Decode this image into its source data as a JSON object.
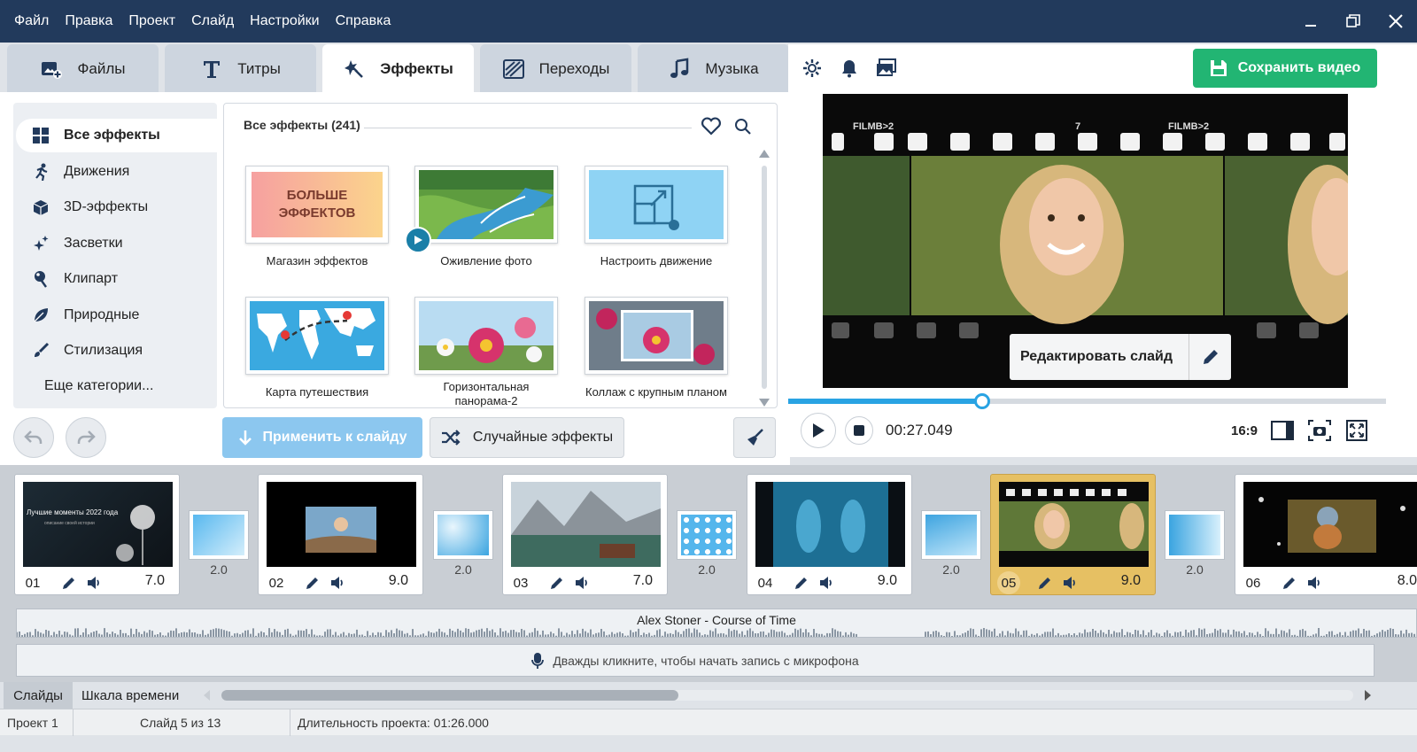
{
  "menu": [
    "Файл",
    "Правка",
    "Проект",
    "Слайд",
    "Настройки",
    "Справка"
  ],
  "tabs": [
    {
      "label": "Файлы",
      "icon": "add-photo-icon"
    },
    {
      "label": "Титры",
      "icon": "text-t-icon"
    },
    {
      "label": "Эффекты",
      "icon": "effects-star-icon",
      "active": true
    },
    {
      "label": "Переходы",
      "icon": "transition-icon"
    },
    {
      "label": "Музыка",
      "icon": "music-note-icon"
    }
  ],
  "categories": [
    {
      "label": "Все эффекты",
      "icon": "grid-icon",
      "active": true
    },
    {
      "label": "Движения",
      "icon": "running-icon"
    },
    {
      "label": "3D-эффекты",
      "icon": "cube-icon"
    },
    {
      "label": "Засветки",
      "icon": "sparkle-icon"
    },
    {
      "label": "Клипарт",
      "icon": "pin-icon"
    },
    {
      "label": "Природные",
      "icon": "leaf-icon"
    },
    {
      "label": "Стилизация",
      "icon": "brush-icon"
    },
    {
      "label": "Еще категории...",
      "icon": ""
    }
  ],
  "gallery": {
    "title": "Все эффекты (241)",
    "items": [
      {
        "label": "Магазин эффектов",
        "badge": "БОЛЬШЕ ЭФФЕКТОВ"
      },
      {
        "label": "Оживление фото"
      },
      {
        "label": "Настроить движение"
      },
      {
        "label": "Карта путешествия"
      },
      {
        "label": "Горизонтальная панорама-2"
      },
      {
        "label": "Коллаж с крупным планом"
      }
    ]
  },
  "buttons": {
    "apply": "Применить к слайду",
    "random": "Случайные эффекты",
    "save": "Сохранить видео",
    "edit_slide": "Редактировать слайд"
  },
  "player": {
    "time": "00:27.049",
    "ratio": "16:9",
    "progress": 0.325
  },
  "slides": [
    {
      "num": "01",
      "dur": "7.0",
      "caption": "Лучшие моменты 2022 года",
      "subcaption": "описание своей истории"
    },
    {
      "num": "02",
      "dur": "9.0"
    },
    {
      "num": "03",
      "dur": "7.0"
    },
    {
      "num": "04",
      "dur": "9.0"
    },
    {
      "num": "05",
      "dur": "9.0",
      "selected": true
    },
    {
      "num": "06",
      "dur": "8.0"
    }
  ],
  "transitions": [
    "2.0",
    "2.0",
    "2.0",
    "2.0",
    "2.0"
  ],
  "audio_track": "Alex Stoner - Course of Time",
  "mic_hint": "Дважды кликните, чтобы начать запись с микрофона",
  "view_tabs": [
    "Слайды",
    "Шкала времени"
  ],
  "status": {
    "project": "Проект 1",
    "slide": "Слайд 5 из 13",
    "duration": "Длительность проекта: 01:26.000"
  },
  "colors": {
    "titlebar": "#223a5c",
    "accent": "#29a3e3",
    "save": "#22b573",
    "selected_slide": "#e6c063"
  }
}
